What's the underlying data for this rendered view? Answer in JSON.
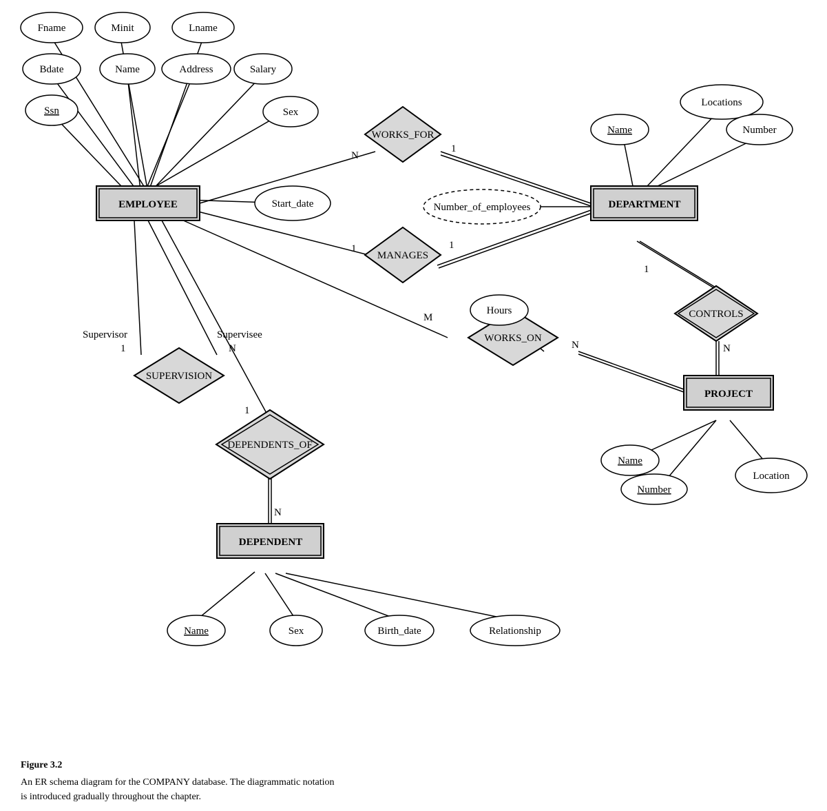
{
  "caption": {
    "title": "Figure 3.2",
    "line1": "An ER schema diagram for the COMPANY database. The diagrammatic notation",
    "line2": "is introduced gradually throughout the chapter."
  },
  "entities": {
    "employee": "EMPLOYEE",
    "department": "DEPARTMENT",
    "project": "PROJECT",
    "dependent": "DEPENDENT"
  },
  "relationships": {
    "works_for": "WORKS_FOR",
    "manages": "MANAGES",
    "works_on": "WORKS_ON",
    "controls": "CONTROLS",
    "supervision": "SUPERVISION",
    "dependents_of": "DEPENDENTS_OF"
  }
}
